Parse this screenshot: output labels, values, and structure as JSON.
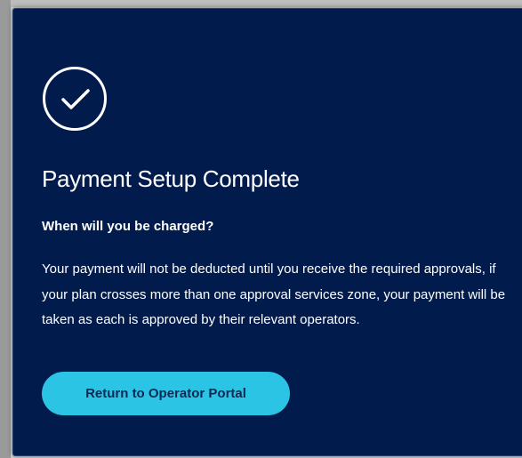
{
  "modal": {
    "icon": "check-circle-icon",
    "title": "Payment Setup Complete",
    "subtitle": "When will you be charged?",
    "body": "Your payment will not be deducted until you receive the required approvals, if your plan crosses more than one approval services zone, your payment will be taken as each is approved by their relevant operators.",
    "button_label": "Return to Operator Portal"
  },
  "colors": {
    "modal_background": "#011b4d",
    "button_background": "#2cc4e4",
    "button_text": "#0a2a55",
    "text": "#ffffff"
  }
}
